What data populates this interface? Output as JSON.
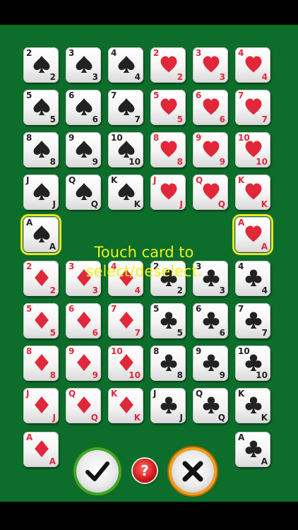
{
  "hint": {
    "line1": "Touch card to",
    "line2": "select/deselect."
  },
  "buttons": {
    "help_label": "?",
    "ok_icon": "checkmark-icon",
    "cancel_icon": "x-icon",
    "help_icon": "question-icon"
  },
  "colors": {
    "felt": "#0d6d2a",
    "hint_text": "#f0f020",
    "red_suit": "#e0283a",
    "black_suit": "#222222",
    "select_outline": "#e8e820",
    "ok_ring": "#3fa82a",
    "cancel_ring": "#f0a020"
  },
  "cards": [
    {
      "rank": "2",
      "suit": "spade",
      "selected": false
    },
    {
      "rank": "3",
      "suit": "spade",
      "selected": false
    },
    {
      "rank": "4",
      "suit": "spade",
      "selected": false
    },
    {
      "rank": "2",
      "suit": "heart",
      "selected": false
    },
    {
      "rank": "3",
      "suit": "heart",
      "selected": false
    },
    {
      "rank": "4",
      "suit": "heart",
      "selected": false
    },
    {
      "rank": "5",
      "suit": "spade",
      "selected": false
    },
    {
      "rank": "6",
      "suit": "spade",
      "selected": false
    },
    {
      "rank": "7",
      "suit": "spade",
      "selected": false
    },
    {
      "rank": "5",
      "suit": "heart",
      "selected": false
    },
    {
      "rank": "6",
      "suit": "heart",
      "selected": false
    },
    {
      "rank": "7",
      "suit": "heart",
      "selected": false
    },
    {
      "rank": "8",
      "suit": "spade",
      "selected": false
    },
    {
      "rank": "9",
      "suit": "spade",
      "selected": false
    },
    {
      "rank": "10",
      "suit": "spade",
      "selected": false
    },
    {
      "rank": "8",
      "suit": "heart",
      "selected": false
    },
    {
      "rank": "9",
      "suit": "heart",
      "selected": false
    },
    {
      "rank": "10",
      "suit": "heart",
      "selected": false
    },
    {
      "rank": "J",
      "suit": "spade",
      "selected": false
    },
    {
      "rank": "Q",
      "suit": "spade",
      "selected": false
    },
    {
      "rank": "K",
      "suit": "spade",
      "selected": false
    },
    {
      "rank": "J",
      "suit": "heart",
      "selected": false
    },
    {
      "rank": "Q",
      "suit": "heart",
      "selected": false
    },
    {
      "rank": "K",
      "suit": "heart",
      "selected": false
    },
    {
      "rank": "A",
      "suit": "spade",
      "selected": true
    },
    {
      "rank": "A",
      "suit": "heart",
      "selected": true
    },
    {
      "rank": "2",
      "suit": "diamond",
      "selected": false
    },
    {
      "rank": "3",
      "suit": "diamond",
      "selected": false
    },
    {
      "rank": "4",
      "suit": "diamond",
      "selected": false
    },
    {
      "rank": "2",
      "suit": "club",
      "selected": false
    },
    {
      "rank": "3",
      "suit": "club",
      "selected": false
    },
    {
      "rank": "4",
      "suit": "club",
      "selected": false
    },
    {
      "rank": "5",
      "suit": "diamond",
      "selected": false
    },
    {
      "rank": "6",
      "suit": "diamond",
      "selected": false
    },
    {
      "rank": "7",
      "suit": "diamond",
      "selected": false
    },
    {
      "rank": "5",
      "suit": "club",
      "selected": false
    },
    {
      "rank": "6",
      "suit": "club",
      "selected": false
    },
    {
      "rank": "7",
      "suit": "club",
      "selected": false
    },
    {
      "rank": "8",
      "suit": "diamond",
      "selected": false
    },
    {
      "rank": "9",
      "suit": "diamond",
      "selected": false
    },
    {
      "rank": "10",
      "suit": "diamond",
      "selected": false
    },
    {
      "rank": "8",
      "suit": "club",
      "selected": false
    },
    {
      "rank": "9",
      "suit": "club",
      "selected": false
    },
    {
      "rank": "10",
      "suit": "club",
      "selected": false
    },
    {
      "rank": "J",
      "suit": "diamond",
      "selected": false
    },
    {
      "rank": "Q",
      "suit": "diamond",
      "selected": false
    },
    {
      "rank": "K",
      "suit": "diamond",
      "selected": false
    },
    {
      "rank": "J",
      "suit": "club",
      "selected": false
    },
    {
      "rank": "Q",
      "suit": "club",
      "selected": false
    },
    {
      "rank": "K",
      "suit": "club",
      "selected": false
    },
    {
      "rank": "A",
      "suit": "diamond",
      "selected": false
    },
    {
      "rank": "A",
      "suit": "club",
      "selected": false
    }
  ]
}
